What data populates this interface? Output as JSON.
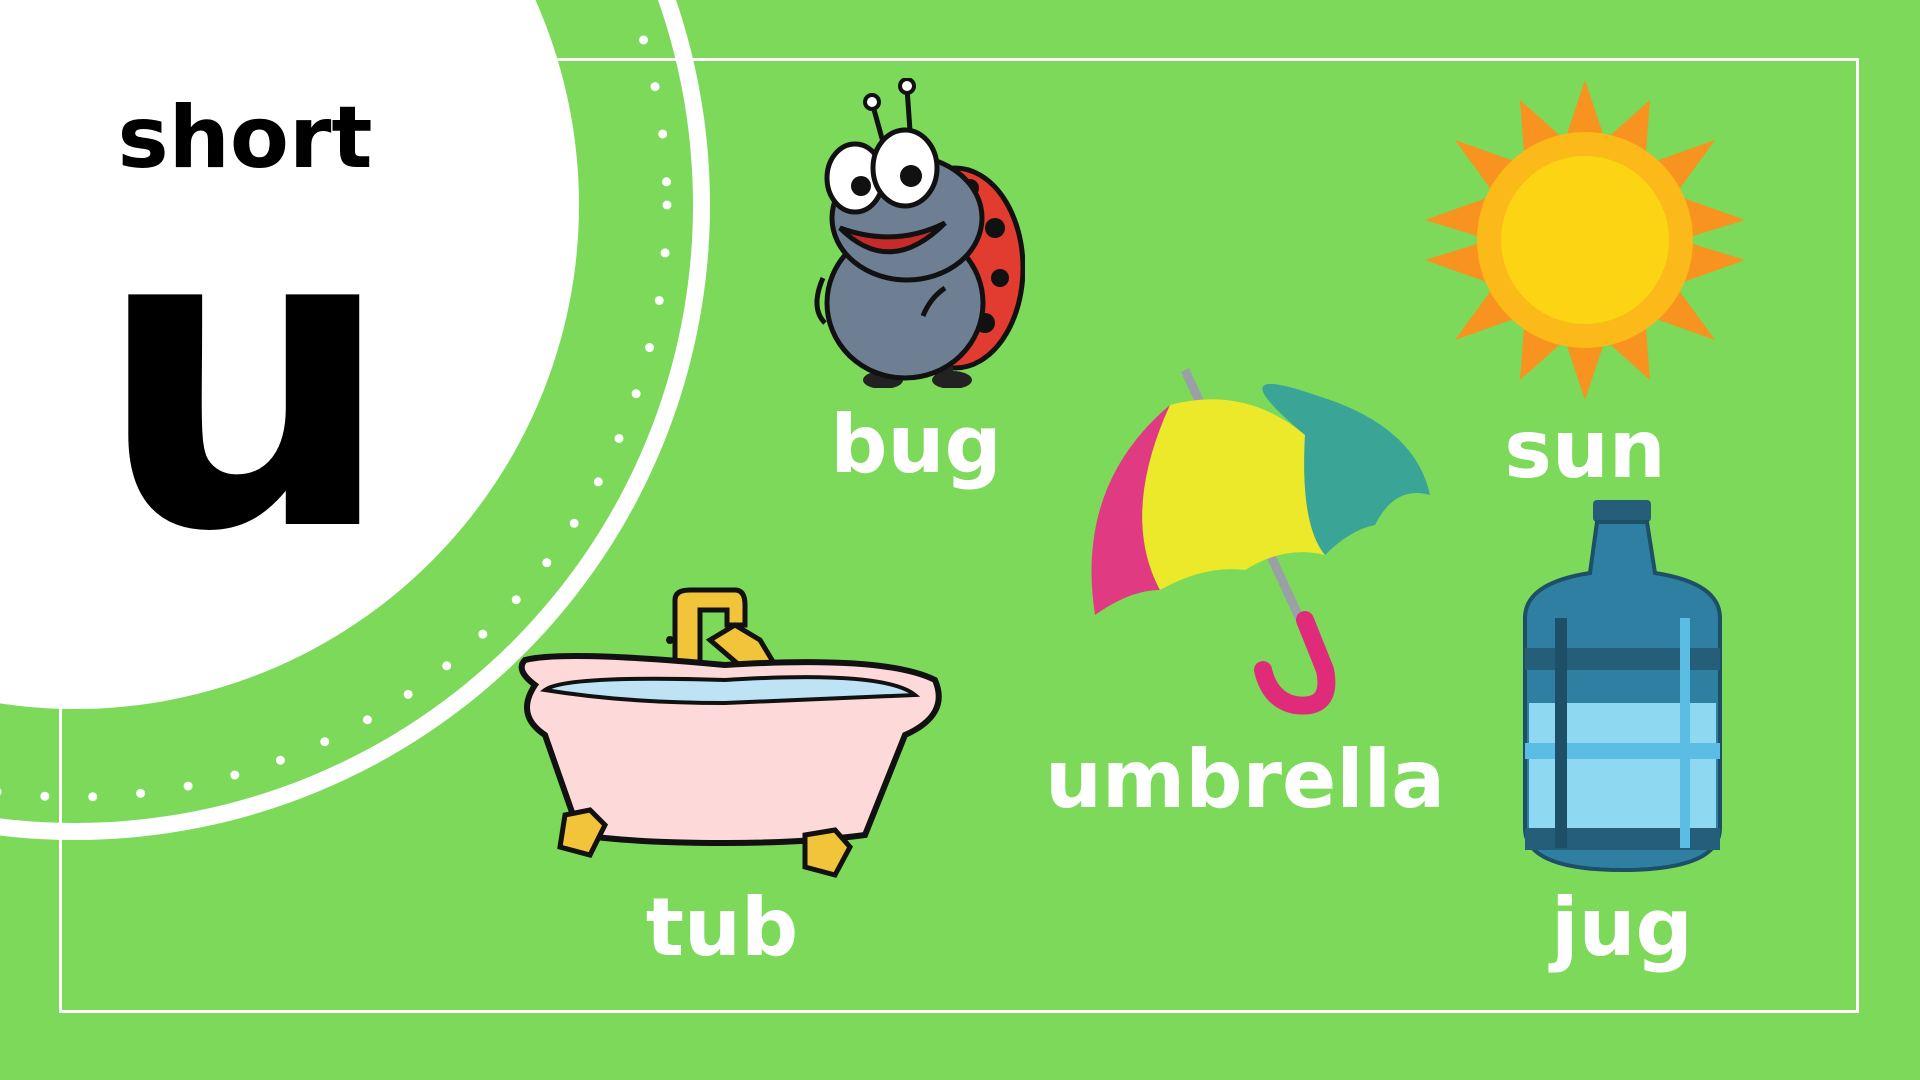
{
  "title": {
    "prefix": "short",
    "letter": "u"
  },
  "words": [
    {
      "label": "bug",
      "icon": "ladybug-icon"
    },
    {
      "label": "sun",
      "icon": "sun-icon"
    },
    {
      "label": "umbrella",
      "icon": "umbrella-icon"
    },
    {
      "label": "tub",
      "icon": "bathtub-icon"
    },
    {
      "label": "jug",
      "icon": "water-jug-icon"
    }
  ],
  "colors": {
    "background": "#7dd95a",
    "frame": "#ffffff",
    "word_text": "#ffffff",
    "title_text": "#000000"
  }
}
